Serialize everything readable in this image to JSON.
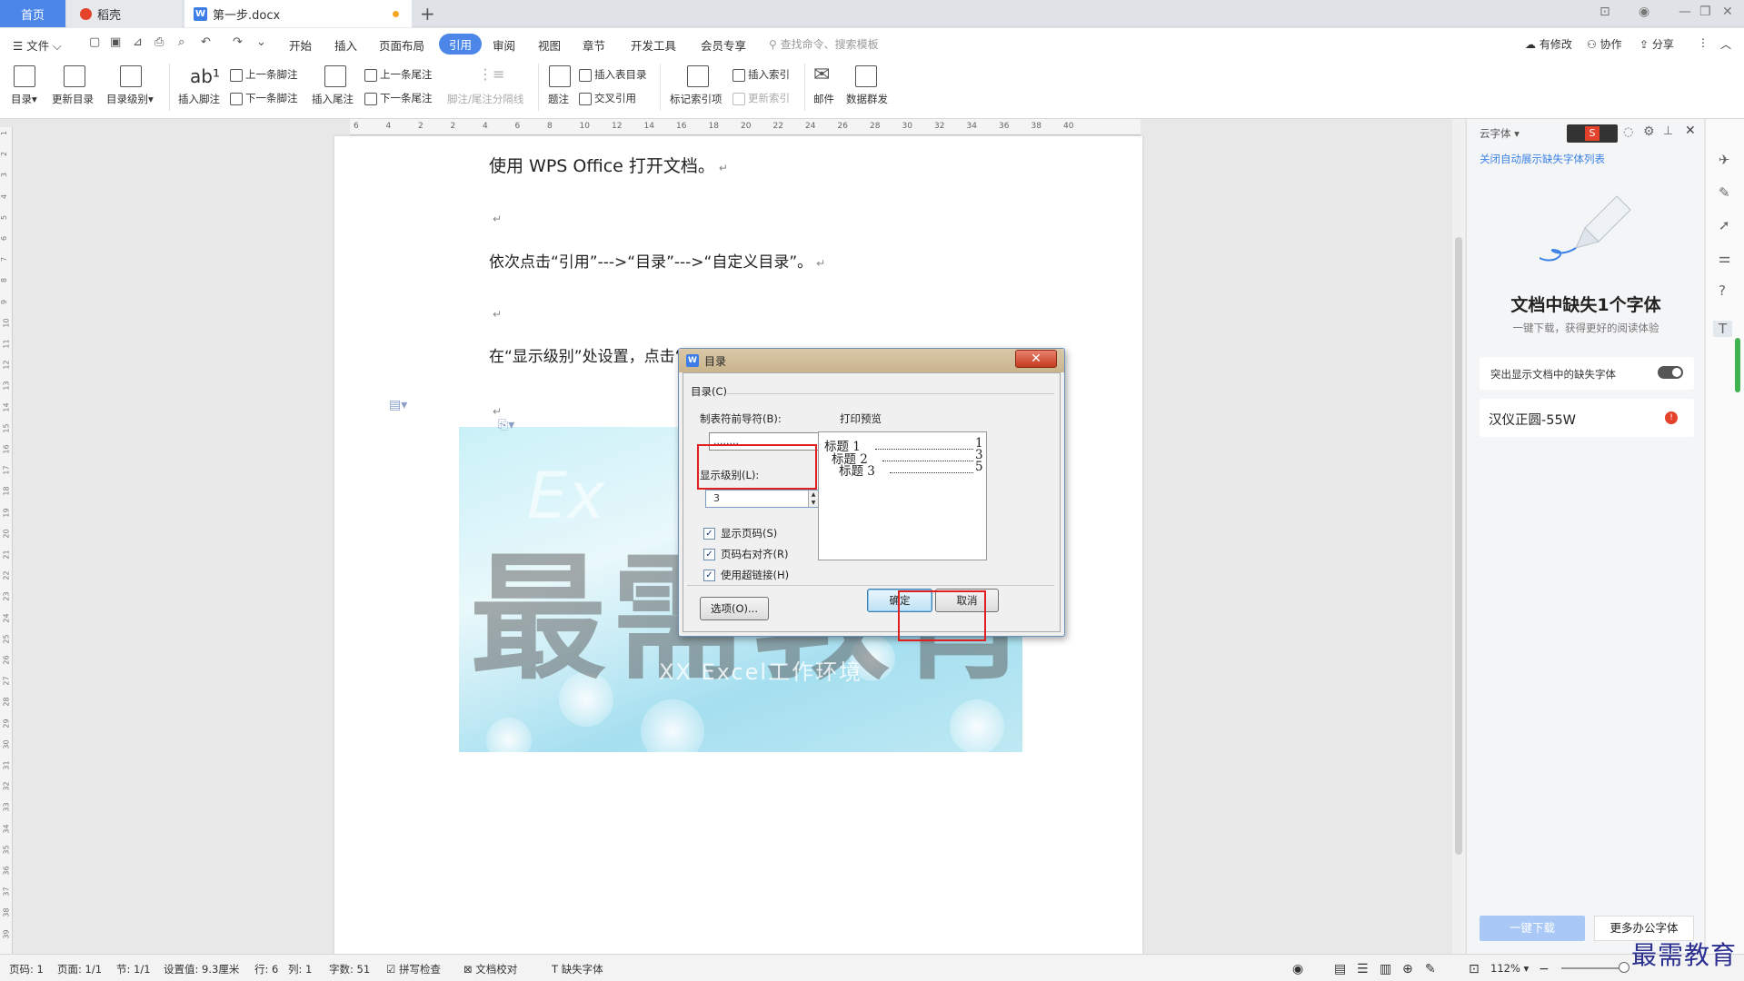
{
  "tabs": {
    "home": "首页",
    "daoke": "稻壳",
    "doc": "第一步.docx"
  },
  "menu": {
    "file": "文件",
    "items": [
      "开始",
      "插入",
      "页面布局",
      "引用",
      "审阅",
      "视图",
      "章节",
      "开发工具",
      "会员专享"
    ],
    "search": "查找命令、搜索模板",
    "right": [
      "有修改",
      "协作",
      "分享"
    ]
  },
  "ribbon": {
    "toc": "目录",
    "update_toc": "更新目录",
    "toc_level": "目录级别",
    "insert_footnote": "插入脚注",
    "prev_footnote": "上一条脚注",
    "next_footnote": "下一条脚注",
    "insert_endnote": "插入尾注",
    "prev_endnote": "上一条尾注",
    "next_endnote": "下一条尾注",
    "separator": "脚注/尾注分隔线",
    "caption": "题注",
    "insert_table_toc": "插入表目录",
    "cross_ref": "交叉引用",
    "mark_index": "标记索引项",
    "insert_index": "插入索引",
    "update_index": "更新索引",
    "mail": "邮件",
    "mail_merge": "数据群发"
  },
  "ruler_top": [
    "6",
    "4",
    "2",
    "2",
    "4",
    "6",
    "8",
    "10",
    "12",
    "14",
    "16",
    "18",
    "20",
    "22",
    "24",
    "26",
    "28",
    "30",
    "32",
    "34",
    "36",
    "38",
    "40"
  ],
  "ruler_left": [
    "1",
    "2",
    "3",
    "4",
    "5",
    "6",
    "7",
    "8",
    "9",
    "10",
    "11",
    "12",
    "13",
    "14",
    "15",
    "16",
    "17",
    "18",
    "19",
    "20",
    "21",
    "22",
    "23",
    "24",
    "25",
    "26",
    "27",
    "28",
    "29",
    "30",
    "31",
    "32",
    "33",
    "34",
    "35",
    "36",
    "37",
    "38",
    "39"
  ],
  "document": {
    "p1": "使用 WPS Office 打开文档。",
    "p2": "依次点击“引用”--->“目录”--->“自定义目录”。",
    "p3": "在“显示级别”处设置，点击“确定”即可。",
    "image_text_big": "最需教育",
    "image_text_small": "XX Excel工作环境",
    "image_text_ex": "Ex"
  },
  "dialog": {
    "title": "目录",
    "group": "目录(C)",
    "leader_label": "制表符前导符(B):",
    "leader_value": "........",
    "level_label": "显示级别(L):",
    "level_value": "3",
    "preview_label": "打印预览",
    "preview": [
      {
        "text": "标题 1",
        "page": "1"
      },
      {
        "text": "标题 2",
        "page": "3"
      },
      {
        "text": "标题 3",
        "page": "5"
      }
    ],
    "show_page": "显示页码(S)",
    "right_align": "页码右对齐(R)",
    "hyperlink": "使用超链接(H)",
    "options": "选项(O)...",
    "ok": "确定",
    "cancel": "取消"
  },
  "sidepanel": {
    "head": "云字体",
    "link": "关闭自动展示缺失字体列表",
    "title": "文档中缺失1个字体",
    "subtitle": "一键下载，获得更好的阅读体验",
    "highlight": "突出显示文档中的缺失字体",
    "font_name": "汉仪正圆-55W",
    "download": "一键下载",
    "more_fonts": "更多办公字体"
  },
  "status": {
    "page": "页码: 1",
    "pages": "页面: 1/1",
    "section": "节: 1/1",
    "setting": "设置值: 9.3厘米",
    "row": "行: 6",
    "col": "列: 1",
    "words": "字数: 51",
    "spell": "拼写检查",
    "proof": "文档校对",
    "missing_font": "缺失字体",
    "zoom": "112%"
  },
  "brand": "最需教育"
}
